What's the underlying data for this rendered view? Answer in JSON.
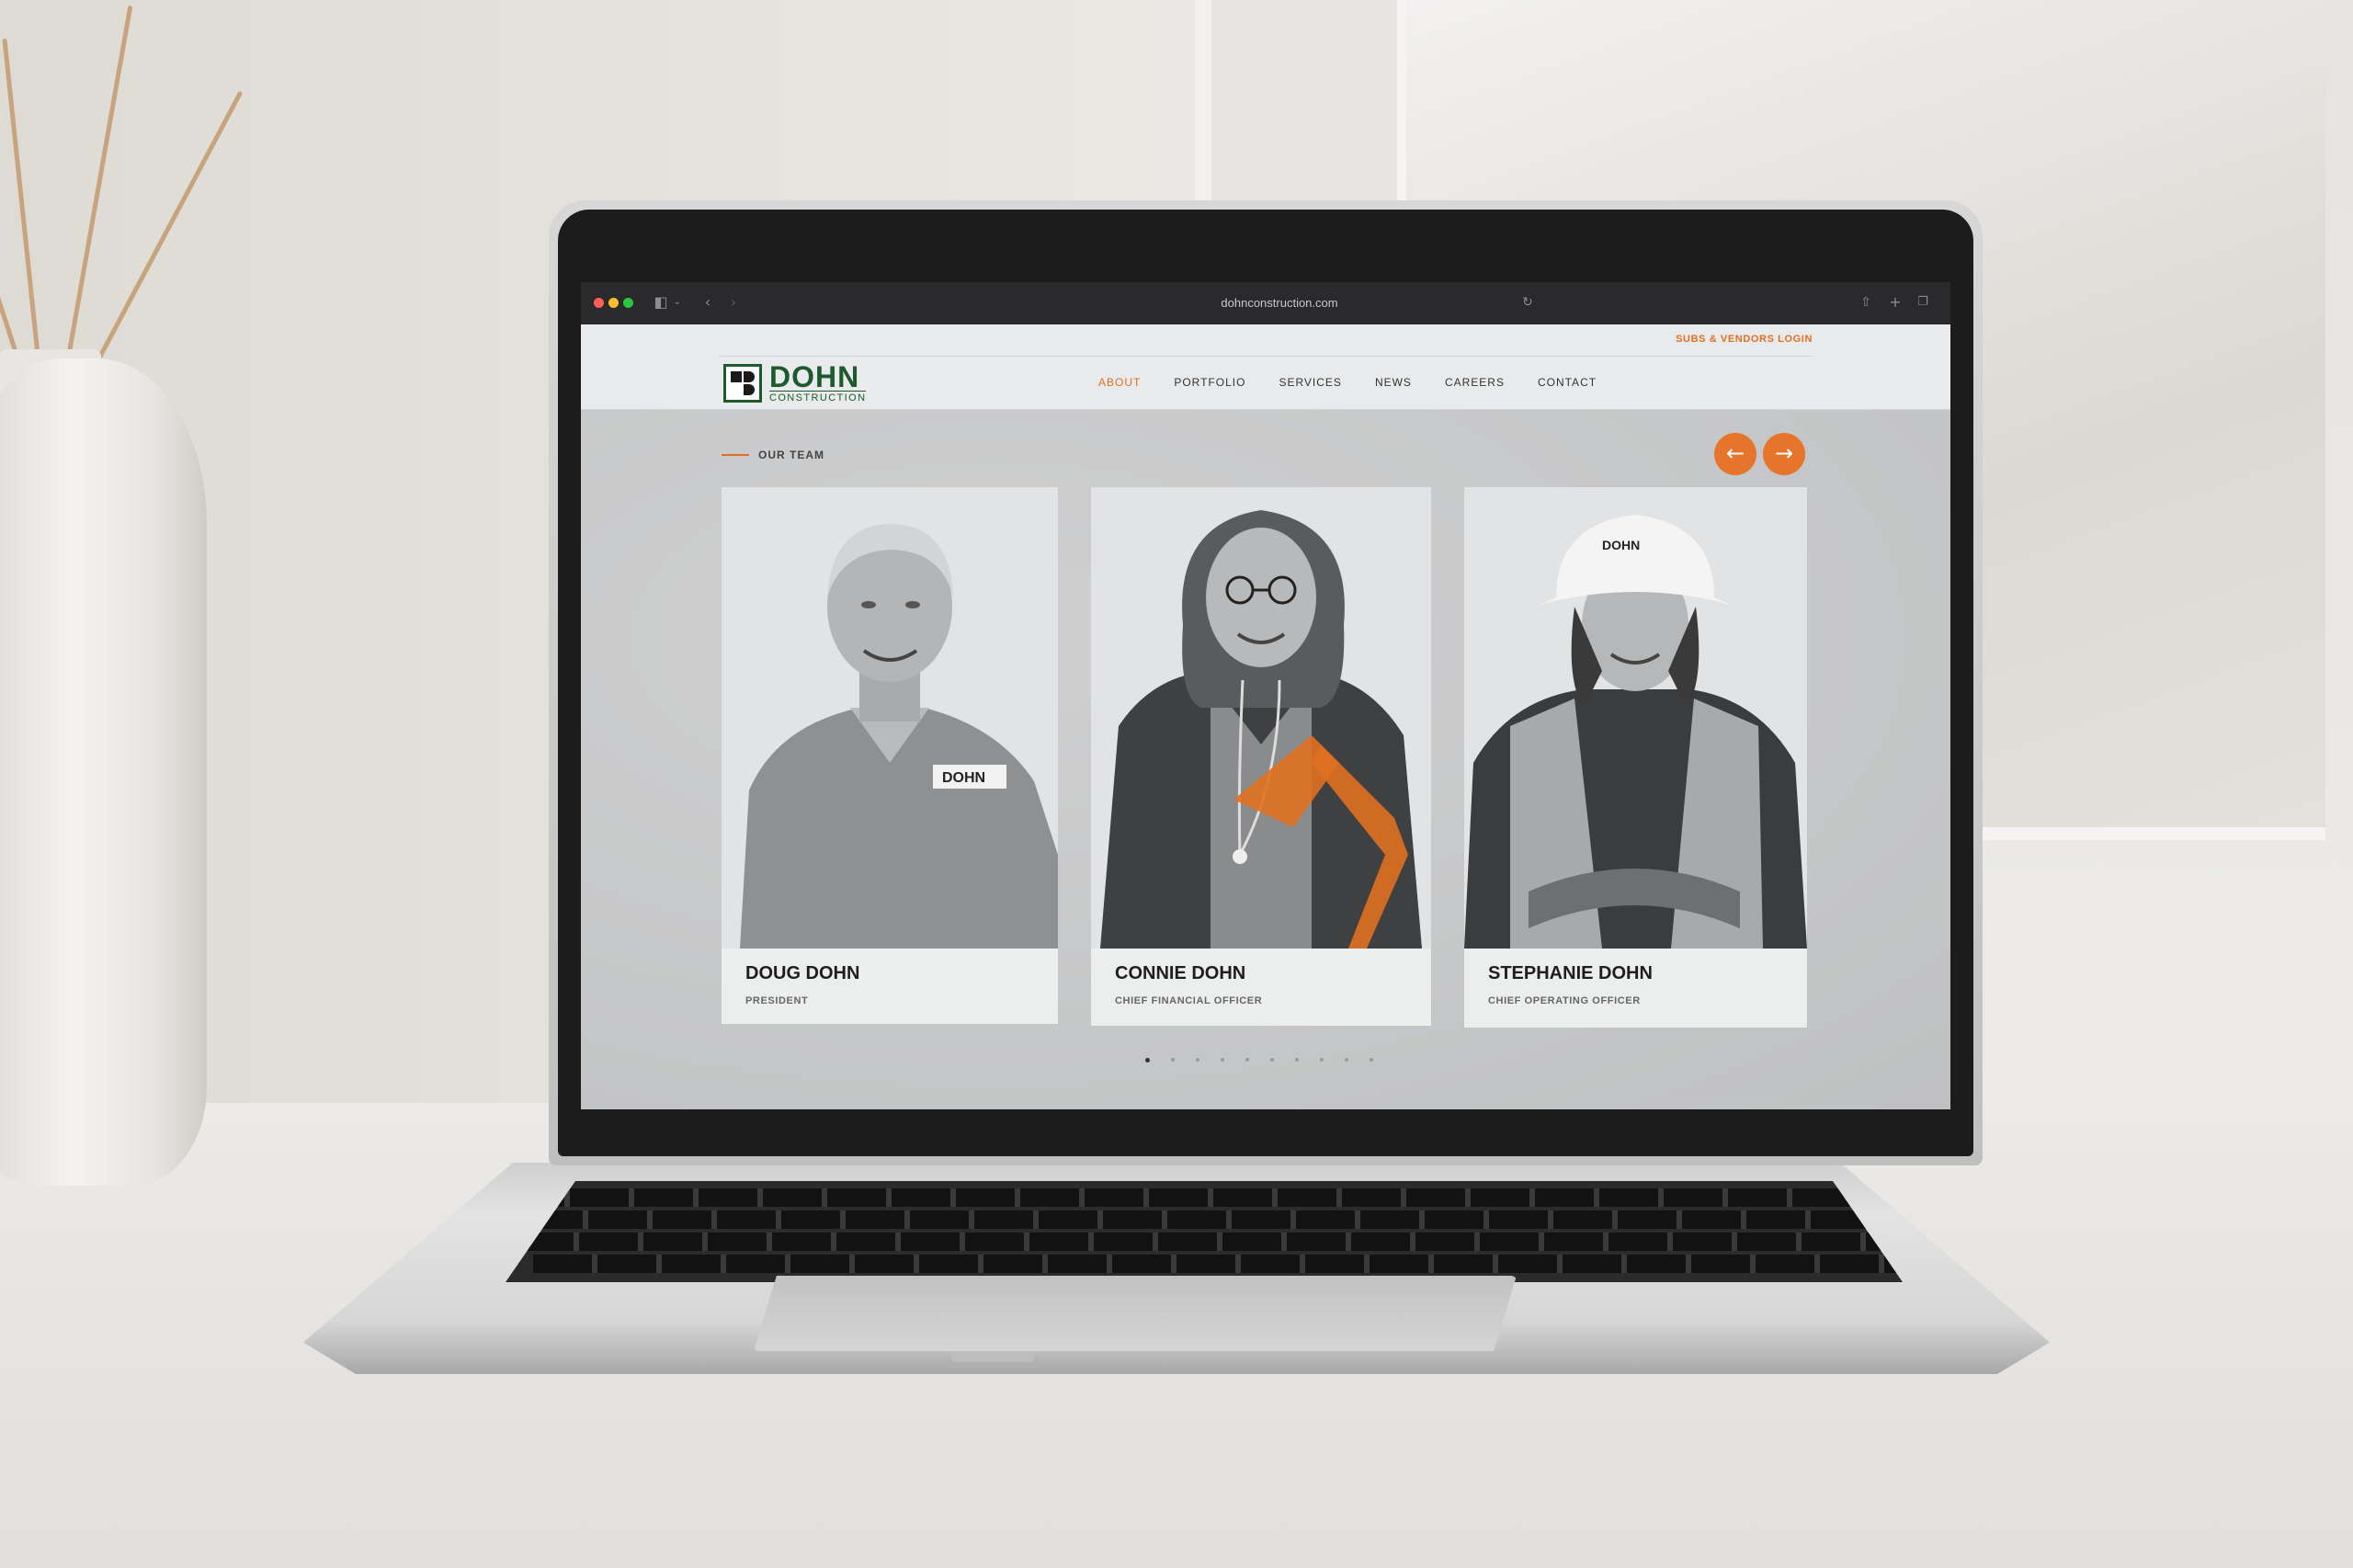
{
  "browser": {
    "url": "dohnconstruction.com",
    "back_icon": "chevron-left-icon",
    "forward_icon": "chevron-right-icon",
    "sidebar_icon": "sidebar-icon",
    "reload_icon": "reload-icon",
    "share_icon": "share-icon",
    "new_tab_icon": "plus-icon",
    "tabs_icon": "tabs-overview-icon"
  },
  "site": {
    "top_link": "SUBS & VENDORS LOGIN",
    "logo": {
      "name": "DOHN",
      "sub": "CONSTRUCTION"
    },
    "nav": [
      {
        "label": "ABOUT",
        "active": true
      },
      {
        "label": "PORTFOLIO",
        "active": false
      },
      {
        "label": "SERVICES",
        "active": false
      },
      {
        "label": "NEWS",
        "active": false
      },
      {
        "label": "CAREERS",
        "active": false
      },
      {
        "label": "CONTACT",
        "active": false
      }
    ],
    "section_label": "OUR TEAM",
    "carousel": {
      "prev_icon": "arrow-left-icon",
      "next_icon": "arrow-right-icon",
      "dots": 10,
      "active_dot": 0
    },
    "team": [
      {
        "name": "DOUG DOHN",
        "title": "PRESIDENT"
      },
      {
        "name": "CONNIE DOHN",
        "title": "CHIEF FINANCIAL OFFICER"
      },
      {
        "name": "STEPHANIE DOHN",
        "title": "CHIEF OPERATING OFFICER"
      }
    ],
    "colors": {
      "accent": "#e07021",
      "brand_green": "#1d5a2e"
    }
  }
}
